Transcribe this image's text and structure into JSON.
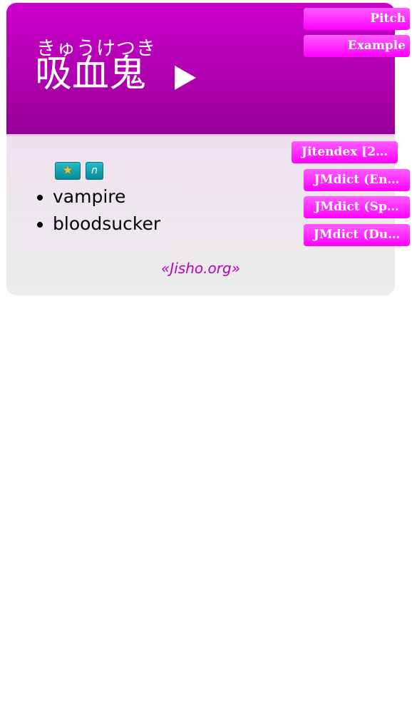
{
  "entry": {
    "reading": "きゅうけつき",
    "word": "吸血鬼",
    "play_icon": "play-triangle"
  },
  "tags": [
    {
      "icon": "star-icon",
      "glyph": "★"
    },
    {
      "label": "n"
    }
  ],
  "definitions": [
    "vampire",
    "bloodsucker"
  ],
  "source": "«Jisho.org»",
  "tabs": {
    "pitch": "Pitch",
    "example": "Example",
    "jitendex": "Jitendex [2…",
    "jmdict_en": "JMdict (En…",
    "jmdict_sp": "JMdict (Sp…",
    "jmdict_du": "JMdict (Du…"
  },
  "colors": {
    "header": "#cc00cc",
    "tab": "#ff33ff",
    "tag": "#0aa0ad",
    "source": "#bb00bb"
  }
}
